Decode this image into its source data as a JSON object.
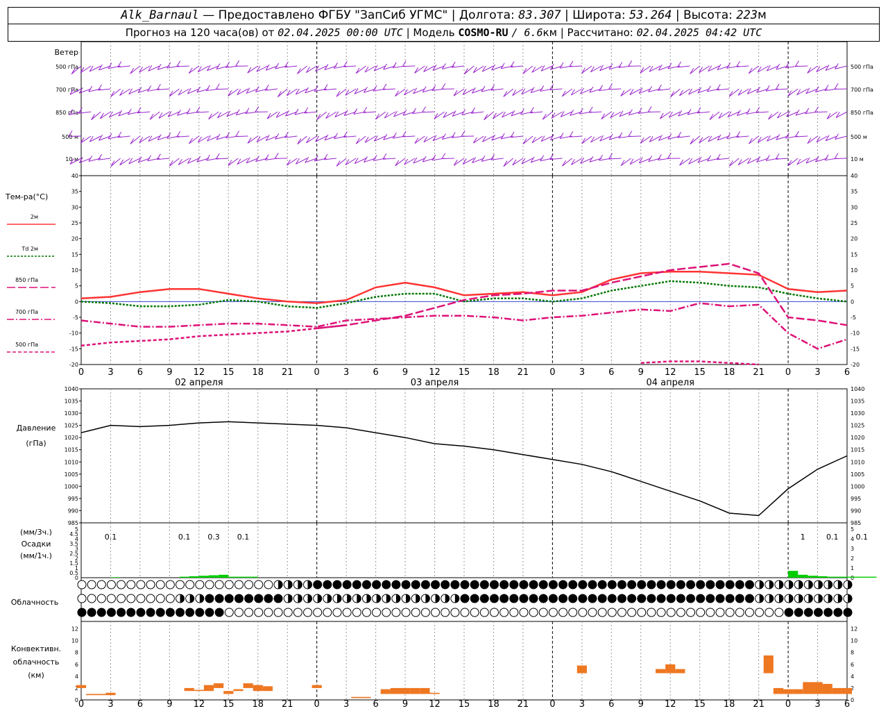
{
  "header": {
    "station": "Alk_Barnaul",
    "provider": "— Предоставлено ФГБУ \"ЗапСиб УГМС\"",
    "lon_label": "| Долгота:",
    "lon": "83.307",
    "lat_label": "| Широта:",
    "lat": "53.264",
    "alt_label": "| Высота:",
    "alt": "223",
    "alt_unit": "м",
    "forecast_label": "Прогноз на 120 часа(ов) от",
    "forecast_start": "02.04.2025 00:00 UTC",
    "model_label": "| Модель",
    "model": "COSMO-RU",
    "model_res": "/ 6.6",
    "model_res_unit": "км",
    "computed_label": "| Рассчитано:",
    "computed": "02.04.2025 04:42 UTC"
  },
  "labels": {
    "wind": "Ветер",
    "wind_levels": [
      "500 гПа",
      "700 гПа",
      "850 гПа",
      "500 м",
      "10 м"
    ],
    "temp": "Тем-ра(°С)",
    "legend": [
      {
        "label": "2м",
        "color": "#ff3333",
        "style": "solid"
      },
      {
        "label": "Td 2м",
        "color": "#007700",
        "style": "dotted"
      },
      {
        "label": "850 гПа",
        "color": "#dd1177",
        "style": "longdash"
      },
      {
        "label": "700 гПа",
        "color": "#dd1177",
        "style": "dashdot"
      },
      {
        "label": "500 гПа",
        "color": "#dd1177",
        "style": "dash"
      }
    ],
    "pressure": [
      "Давление",
      "(гПа)"
    ],
    "precip": [
      "(мм/3ч.)",
      "Осадки",
      "(мм/1ч.)"
    ],
    "cloud": "Облачность",
    "conv": [
      "Конвективн.",
      "облачность",
      "(км)"
    ],
    "dates": [
      "02 апреля",
      "03 апреля",
      "04 апреля"
    ]
  },
  "chart_data": [
    {
      "type": "line",
      "title": "Тем-ра(°С)",
      "x_hours": [
        0,
        3,
        6,
        9,
        12,
        15,
        18,
        21,
        24,
        27,
        30,
        33,
        36,
        39,
        42,
        45,
        48,
        51,
        54,
        57,
        60,
        63,
        66,
        69,
        72,
        75,
        78
      ],
      "x_ticks": [
        "0",
        "3",
        "6",
        "9",
        "12",
        "15",
        "18",
        "21",
        "0",
        "3",
        "6",
        "9",
        "12",
        "15",
        "18",
        "21",
        "0",
        "3",
        "6",
        "9",
        "12",
        "15",
        "18",
        "21",
        "0",
        "3",
        "6"
      ],
      "ylim": [
        -20,
        40
      ],
      "series": [
        {
          "name": "2м",
          "values": [
            1,
            1.5,
            3,
            4,
            4,
            2.5,
            1,
            0,
            -0.5,
            0.5,
            4.5,
            6,
            4.5,
            2,
            2.5,
            3,
            2,
            3,
            7,
            9,
            9.5,
            9.5,
            9,
            8.5,
            4,
            3,
            3.5
          ]
        },
        {
          "name": "Td 2м",
          "values": [
            0,
            -0.5,
            -1.5,
            -1.5,
            -1,
            0.5,
            0,
            -1.5,
            -2,
            -0.5,
            1.5,
            2.5,
            2.5,
            0,
            1,
            1,
            0,
            1,
            3.5,
            5,
            6.5,
            6,
            5,
            4.5,
            2.5,
            1,
            0
          ]
        },
        {
          "name": "850 гПа",
          "values": [
            null,
            null,
            null,
            null,
            null,
            null,
            null,
            null,
            -8.5,
            -7.5,
            -6,
            -4.5,
            -2,
            0.5,
            2,
            2.5,
            3.5,
            3.5,
            6,
            8,
            10,
            11,
            12,
            9,
            -5,
            -6,
            -7.5
          ]
        },
        {
          "name": "700 гПа",
          "values": [
            -6,
            -7,
            -8,
            -8,
            -7.5,
            -7,
            -7,
            -7.5,
            -8,
            -6,
            -5.5,
            -5,
            -4.5,
            -4.5,
            -5,
            -6,
            -5,
            -4.5,
            -3.5,
            -2.5,
            -3,
            -0.5,
            -1.5,
            -1,
            -10,
            -15,
            -12
          ]
        },
        {
          "name": "500 гПа",
          "values": [
            -14,
            -13,
            -12.5,
            -12,
            -11,
            -10.5,
            -10,
            -9.5,
            -8.5,
            -7.5,
            null,
            null,
            null,
            null,
            null,
            null,
            null,
            null,
            null,
            -19.5,
            -19,
            -19,
            -19.5,
            -20,
            null,
            null,
            null
          ]
        }
      ]
    },
    {
      "type": "line",
      "title": "Давление (гПа)",
      "x_hours": [
        0,
        3,
        6,
        9,
        12,
        15,
        18,
        21,
        24,
        27,
        30,
        33,
        36,
        39,
        42,
        45,
        48,
        51,
        54,
        57,
        60,
        63,
        66,
        69,
        72,
        75,
        78
      ],
      "ylim": [
        985,
        1040
      ],
      "values": [
        1022,
        1025,
        1024.5,
        1025,
        1026,
        1026.5,
        1026,
        1025.5,
        1025,
        1024,
        1022,
        1020,
        1017.5,
        1016.5,
        1015,
        1013,
        1011,
        1009,
        1006,
        1002,
        998,
        994,
        989,
        988,
        999,
        1007,
        1012.5
      ]
    },
    {
      "type": "bar",
      "title": "Осадки",
      "ylim": [
        0,
        5
      ],
      "labels": [
        {
          "hour": 3,
          "text": "0.1"
        },
        {
          "hour": 10.5,
          "text": "0.1"
        },
        {
          "hour": 13.5,
          "text": "0.3"
        },
        {
          "hour": 16.5,
          "text": "0.1"
        },
        {
          "hour": 73.5,
          "text": "1"
        },
        {
          "hour": 76.5,
          "text": "0.1"
        },
        {
          "hour": 79.5,
          "text": "0.1"
        }
      ],
      "hourly": [
        {
          "hour": 3,
          "value": 0.05
        },
        {
          "hour": 10,
          "value": 0.1
        },
        {
          "hour": 11,
          "value": 0.15
        },
        {
          "hour": 12,
          "value": 0.2
        },
        {
          "hour": 13,
          "value": 0.25
        },
        {
          "hour": 14,
          "value": 0.3
        },
        {
          "hour": 15,
          "value": 0.1
        },
        {
          "hour": 16,
          "value": 0.1
        },
        {
          "hour": 17,
          "value": 0.1
        },
        {
          "hour": 72,
          "value": 0.7
        },
        {
          "hour": 73,
          "value": 0.3
        },
        {
          "hour": 74,
          "value": 0.2
        },
        {
          "hour": 75,
          "value": 0.15
        },
        {
          "hour": 76,
          "value": 0.1
        },
        {
          "hour": 77,
          "value": 0.1
        },
        {
          "hour": 78,
          "value": 0.1
        },
        {
          "hour": 79,
          "value": 0.1
        },
        {
          "hour": 80,
          "value": 0.1
        }
      ]
    },
    {
      "type": "bar",
      "title": "Конвективн. облачность (км)",
      "ylim": [
        0,
        13
      ],
      "bars": [
        {
          "hour": 0,
          "bottom": 2,
          "top": 2.5
        },
        {
          "hour": 1,
          "bottom": 0.8,
          "top": 1
        },
        {
          "hour": 2,
          "bottom": 0.8,
          "top": 1
        },
        {
          "hour": 3,
          "bottom": 0.8,
          "top": 1.2
        },
        {
          "hour": 11,
          "bottom": 1.5,
          "top": 2
        },
        {
          "hour": 12,
          "bottom": 1.5,
          "top": 1.7
        },
        {
          "hour": 13,
          "bottom": 1.5,
          "top": 2.5
        },
        {
          "hour": 14,
          "bottom": 2,
          "top": 2.8
        },
        {
          "hour": 15,
          "bottom": 1,
          "top": 1.5
        },
        {
          "hour": 16,
          "bottom": 1.5,
          "top": 1.8
        },
        {
          "hour": 17,
          "bottom": 2,
          "top": 2.8
        },
        {
          "hour": 18,
          "bottom": 1.5,
          "top": 2.5
        },
        {
          "hour": 19,
          "bottom": 1.5,
          "top": 2.3
        },
        {
          "hour": 24,
          "bottom": 2,
          "top": 2.5
        },
        {
          "hour": 28,
          "bottom": 0.3,
          "top": 0.5
        },
        {
          "hour": 29,
          "bottom": 0.3,
          "top": 0.5
        },
        {
          "hour": 31,
          "bottom": 1,
          "top": 1.8
        },
        {
          "hour": 32,
          "bottom": 1,
          "top": 2
        },
        {
          "hour": 33,
          "bottom": 1,
          "top": 2
        },
        {
          "hour": 34,
          "bottom": 1,
          "top": 2
        },
        {
          "hour": 35,
          "bottom": 1,
          "top": 2
        },
        {
          "hour": 36,
          "bottom": 1,
          "top": 1.2
        },
        {
          "hour": 51,
          "bottom": 4.5,
          "top": 5.8
        },
        {
          "hour": 59,
          "bottom": 4.5,
          "top": 5.2
        },
        {
          "hour": 60,
          "bottom": 4.5,
          "top": 6
        },
        {
          "hour": 61,
          "bottom": 4.5,
          "top": 5.2
        },
        {
          "hour": 70,
          "bottom": 4.5,
          "top": 7.5
        },
        {
          "hour": 71,
          "bottom": 1,
          "top": 2
        },
        {
          "hour": 72,
          "bottom": 1,
          "top": 1.8
        },
        {
          "hour": 73,
          "bottom": 1,
          "top": 1.8
        },
        {
          "hour": 74,
          "bottom": 1,
          "top": 3
        },
        {
          "hour": 75,
          "bottom": 1,
          "top": 3
        },
        {
          "hour": 76,
          "bottom": 1,
          "top": 2.7
        },
        {
          "hour": 77,
          "bottom": 1,
          "top": 2
        },
        {
          "hour": 78,
          "bottom": 1,
          "top": 2
        }
      ]
    }
  ],
  "colors": {
    "wind": "#9922cc",
    "temp2m": "#ff3333",
    "td": "#007700",
    "upper": "#dd1177",
    "zero": "#3344cc",
    "precip": "#00cc00",
    "conv": "#ee7722"
  }
}
